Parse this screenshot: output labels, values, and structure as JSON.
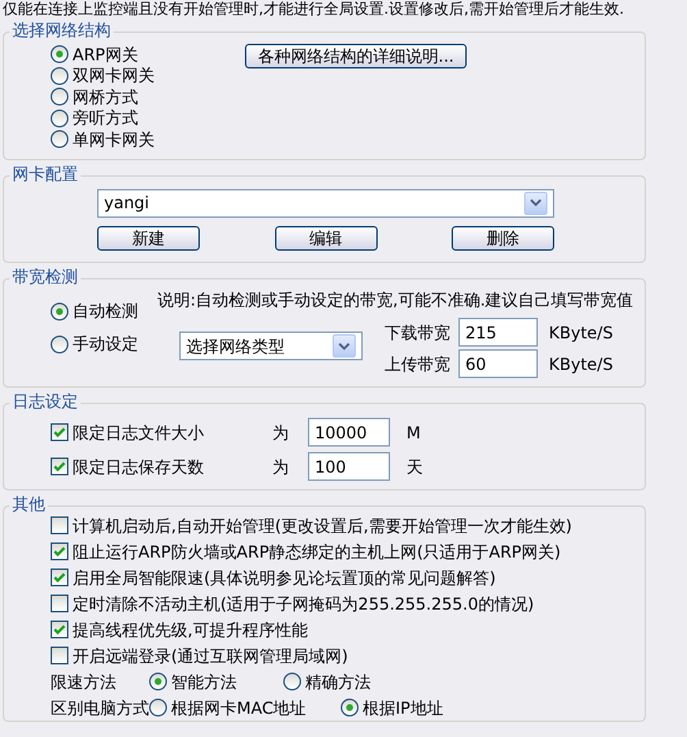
{
  "notice": "仅能在连接上监控端且没有开始管理时,才能进行全局设置.设置修改后,需开始管理后才能生效.",
  "network_structure": {
    "title": "选择网络结构",
    "options": [
      {
        "label": "ARP网关",
        "selected": true
      },
      {
        "label": "双网卡网关",
        "selected": false
      },
      {
        "label": "网桥方式",
        "selected": false
      },
      {
        "label": "旁听方式",
        "selected": false
      },
      {
        "label": "单网卡网关",
        "selected": false
      }
    ],
    "details_button": "各种网络结构的详细说明..."
  },
  "nic_config": {
    "title": "网卡配置",
    "profile": "yangi",
    "buttons": [
      "新建",
      "编辑",
      "删除"
    ]
  },
  "bandwidth": {
    "title": "带宽检测",
    "modes": [
      {
        "label": "自动检测",
        "selected": true
      },
      {
        "label": "手动设定",
        "selected": false
      }
    ],
    "note": "说明:自动检测或手动设定的带宽,可能不准确.建议自己填写带宽值",
    "network_type": "选择网络类型",
    "rates": [
      {
        "label": "下载带宽",
        "value": "215",
        "unit": "KByte/S"
      },
      {
        "label": "上传带宽",
        "value": "60",
        "unit": "KByte/S"
      }
    ]
  },
  "log": {
    "title": "日志设定",
    "rows": [
      {
        "label": "限定日志文件大小",
        "checked": true,
        "prefix": "为",
        "value": "10000",
        "unit": "M"
      },
      {
        "label": "限定日志保存天数",
        "checked": true,
        "prefix": "为",
        "value": "100",
        "unit": "天"
      }
    ]
  },
  "other": {
    "title": "其他",
    "options": [
      {
        "label": "计算机启动后,自动开始管理(更改设置后,需要开始管理一次才能生效)",
        "checked": false
      },
      {
        "label": "阻止运行ARP防火墙或ARP静态绑定的主机上网(只适用于ARP网关)",
        "checked": true
      },
      {
        "label": "启用全局智能限速(具体说明参见论坛置顶的常见问题解答)",
        "checked": true
      },
      {
        "label": "定时清除不活动主机(适用于子网掩码为255.255.255.0的情况)",
        "checked": false
      },
      {
        "label": "提高线程优先级,可提升程序性能",
        "checked": true
      },
      {
        "label": "开启远端登录(通过互联网管理局域网)",
        "checked": false
      }
    ],
    "choices": [
      {
        "label": "限速方法",
        "options": [
          {
            "label": "智能方法",
            "selected": true
          },
          {
            "label": "精确方法",
            "selected": false
          }
        ]
      },
      {
        "label": "区别电脑方式",
        "options": [
          {
            "label": "根据网卡MAC地址",
            "selected": false
          },
          {
            "label": "根据IP地址",
            "selected": true
          }
        ]
      }
    ]
  }
}
